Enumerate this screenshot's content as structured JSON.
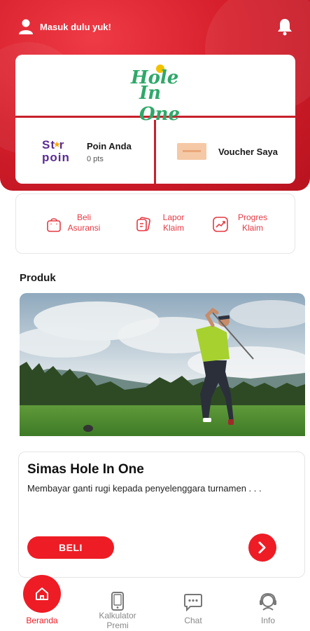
{
  "header": {
    "login_prompt": "Masuk dulu yuk!"
  },
  "brand": {
    "logo_line1": "Hole",
    "logo_line2": "In One"
  },
  "points": {
    "logo_text_top": "St r",
    "logo_text_bottom": "poin",
    "title": "Poin Anda",
    "value": "0 pts"
  },
  "voucher": {
    "title": "Voucher Saya"
  },
  "actions": [
    {
      "label": "Beli Asuransi",
      "icon": "bag-icon"
    },
    {
      "label": "Lapor Klaim",
      "icon": "claim-report-icon"
    },
    {
      "label": "Progres Klaim",
      "icon": "progress-chart-icon"
    }
  ],
  "products_section": {
    "title": "Produk"
  },
  "product": {
    "name": "Simas Hole In One",
    "description": "Membayar ganti rugi kepada penyelenggara turnamen . . .",
    "buy_label": "BELI"
  },
  "bottom_nav": [
    {
      "label": "Beranda",
      "icon": "home-icon",
      "active": true
    },
    {
      "label": "Kalkulator Premi",
      "icon": "calculator-phone-icon",
      "active": false
    },
    {
      "label": "Chat",
      "icon": "chat-icon",
      "active": false
    },
    {
      "label": "Info",
      "icon": "info-agent-icon",
      "active": false
    }
  ],
  "colors": {
    "brand_red": "#ee1c25",
    "starpoin_purple": "#5a2d91",
    "holeinone_green": "#2fa86a"
  }
}
